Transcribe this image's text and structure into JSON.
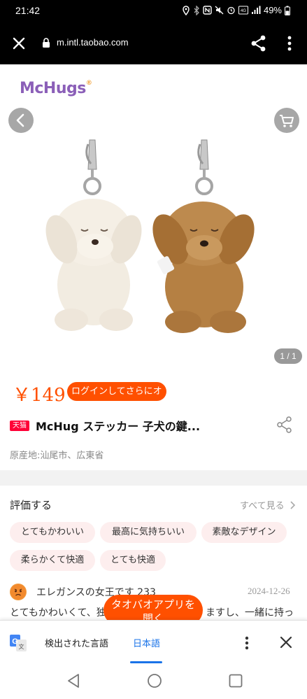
{
  "status_bar": {
    "time": "21:42",
    "battery": "49%"
  },
  "browser": {
    "url": "m.intl.taobao.com"
  },
  "product": {
    "brand": "McHugs",
    "brand_mark": "®",
    "image_counter": "1 / 1",
    "price": "￥149",
    "login_promo": "ログインしてさらにオ",
    "store_badge": "天猫",
    "title": "McHug ステッカー 子犬の鍵...",
    "origin": "原産地:汕尾市、広東省"
  },
  "reviews": {
    "title": "評価する",
    "see_all": "すべて見る",
    "tags": [
      "とてもかわいい",
      "最高に気持ちいい",
      "素敵なデザイン",
      "柔らかくて快適",
      "とても快適"
    ],
    "first_review": {
      "name": "エレガンスの女王です 233",
      "date": "2024-12-26",
      "text": "とてもかわいくて、独",
      "text_tail": "ますし、一緒に持っ"
    }
  },
  "app_banner": {
    "line1": "タオバオアプリを",
    "line2": "開く"
  },
  "translate_bar": {
    "detected": "検出された言語",
    "target": "日本語"
  },
  "colors": {
    "accent": "#ff5000",
    "tmall": "#ff0036",
    "tag_bg": "#fdeeee",
    "link_blue": "#1a73e8"
  }
}
